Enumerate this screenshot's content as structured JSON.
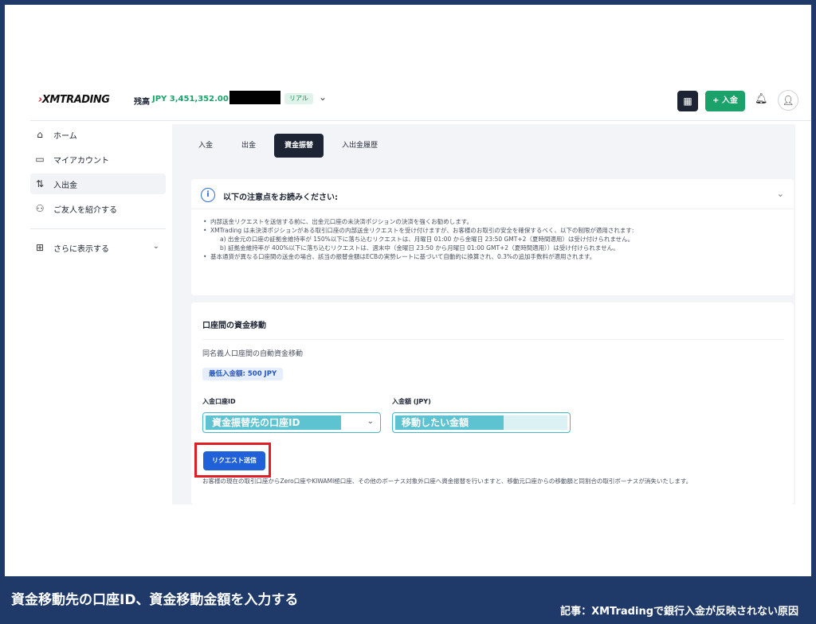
{
  "header": {
    "logo": "XMTRADING",
    "balance_label": "残高",
    "balance_value": "JPY 3,451,352.00",
    "account_type": "リアル",
    "deposit_button": "+ 入金",
    "icons": {
      "qr": "qr-code-icon",
      "bell": "bell-icon",
      "user": "user-icon",
      "chevron": "chevron-down-icon"
    }
  },
  "sidebar": {
    "items": [
      {
        "label": "ホーム",
        "icon": "⌂"
      },
      {
        "label": "マイアカウント",
        "icon": "▭"
      },
      {
        "label": "入出金",
        "icon": "⇅"
      },
      {
        "label": "ご友人を紹介する",
        "icon": "⚇"
      }
    ],
    "more_label": "さらに表示する",
    "more_icon": "⊞"
  },
  "tabs": [
    "入金",
    "出金",
    "資金振替",
    "入出金履歴"
  ],
  "notice": {
    "title": "以下の注意点をお読みください:",
    "lines": [
      "内部送金リクエストを送信する前に、出金元口座の未決済ポジションの決済を強くお勧めします。",
      "XMTrading は未決済ポジションがある取引口座の内部送金リクエストを受け付けますが、お客様のお取引の安全を確保するべく、以下の制限が適用されます:",
      "a) 出金元の口座の証拠金維持率が 150%以下に落ち込むリクエストは、月曜日 01:00 から金曜日 23:50 GMT+2（夏時間適用）は受け付けられません。",
      "b) 証拠金維持率が 400%以下に落ち込むリクエストは、週末中（金曜日 23:50 から月曜日 01:00 GMT+2（夏時間適用））は受け付けられません。",
      "基本通貨が異なる口座間の送金の場合、該当の振替金額はECBの実勢レートに基づいて自動的に換算され、0.3%の追加手数料が適用されます。"
    ]
  },
  "transfer": {
    "title": "口座間の資金移動",
    "subtitle": "同名義人口座間の自動資金移動",
    "min_amount": "最低入金額: 500 JPY",
    "account_label": "入金口座ID",
    "account_value": "資金振替先の口座ID",
    "amount_label": "入金額 (JPY)",
    "amount_value": "移動したい金額",
    "submit": "リクエスト送信",
    "note": "お客様の現在の取引口座からZero口座やKIWAMI極口座、その他のボーナス対象外口座へ資金振替を行いますと、移動元口座からの移動額と同割合の取引ボーナスが消失いたします。"
  },
  "caption": {
    "main": "資金移動先の口座ID、資金移動金額を入力する",
    "sub": "記事：XMTradingで銀行入金が反映されない原因"
  },
  "colors": {
    "accent_green": "#1aa26a",
    "primary_blue": "#2060d8",
    "highlight_red": "#e01c24",
    "overlay_cyan": "#5ec3d1",
    "caption_bg": "#1f3a68"
  }
}
